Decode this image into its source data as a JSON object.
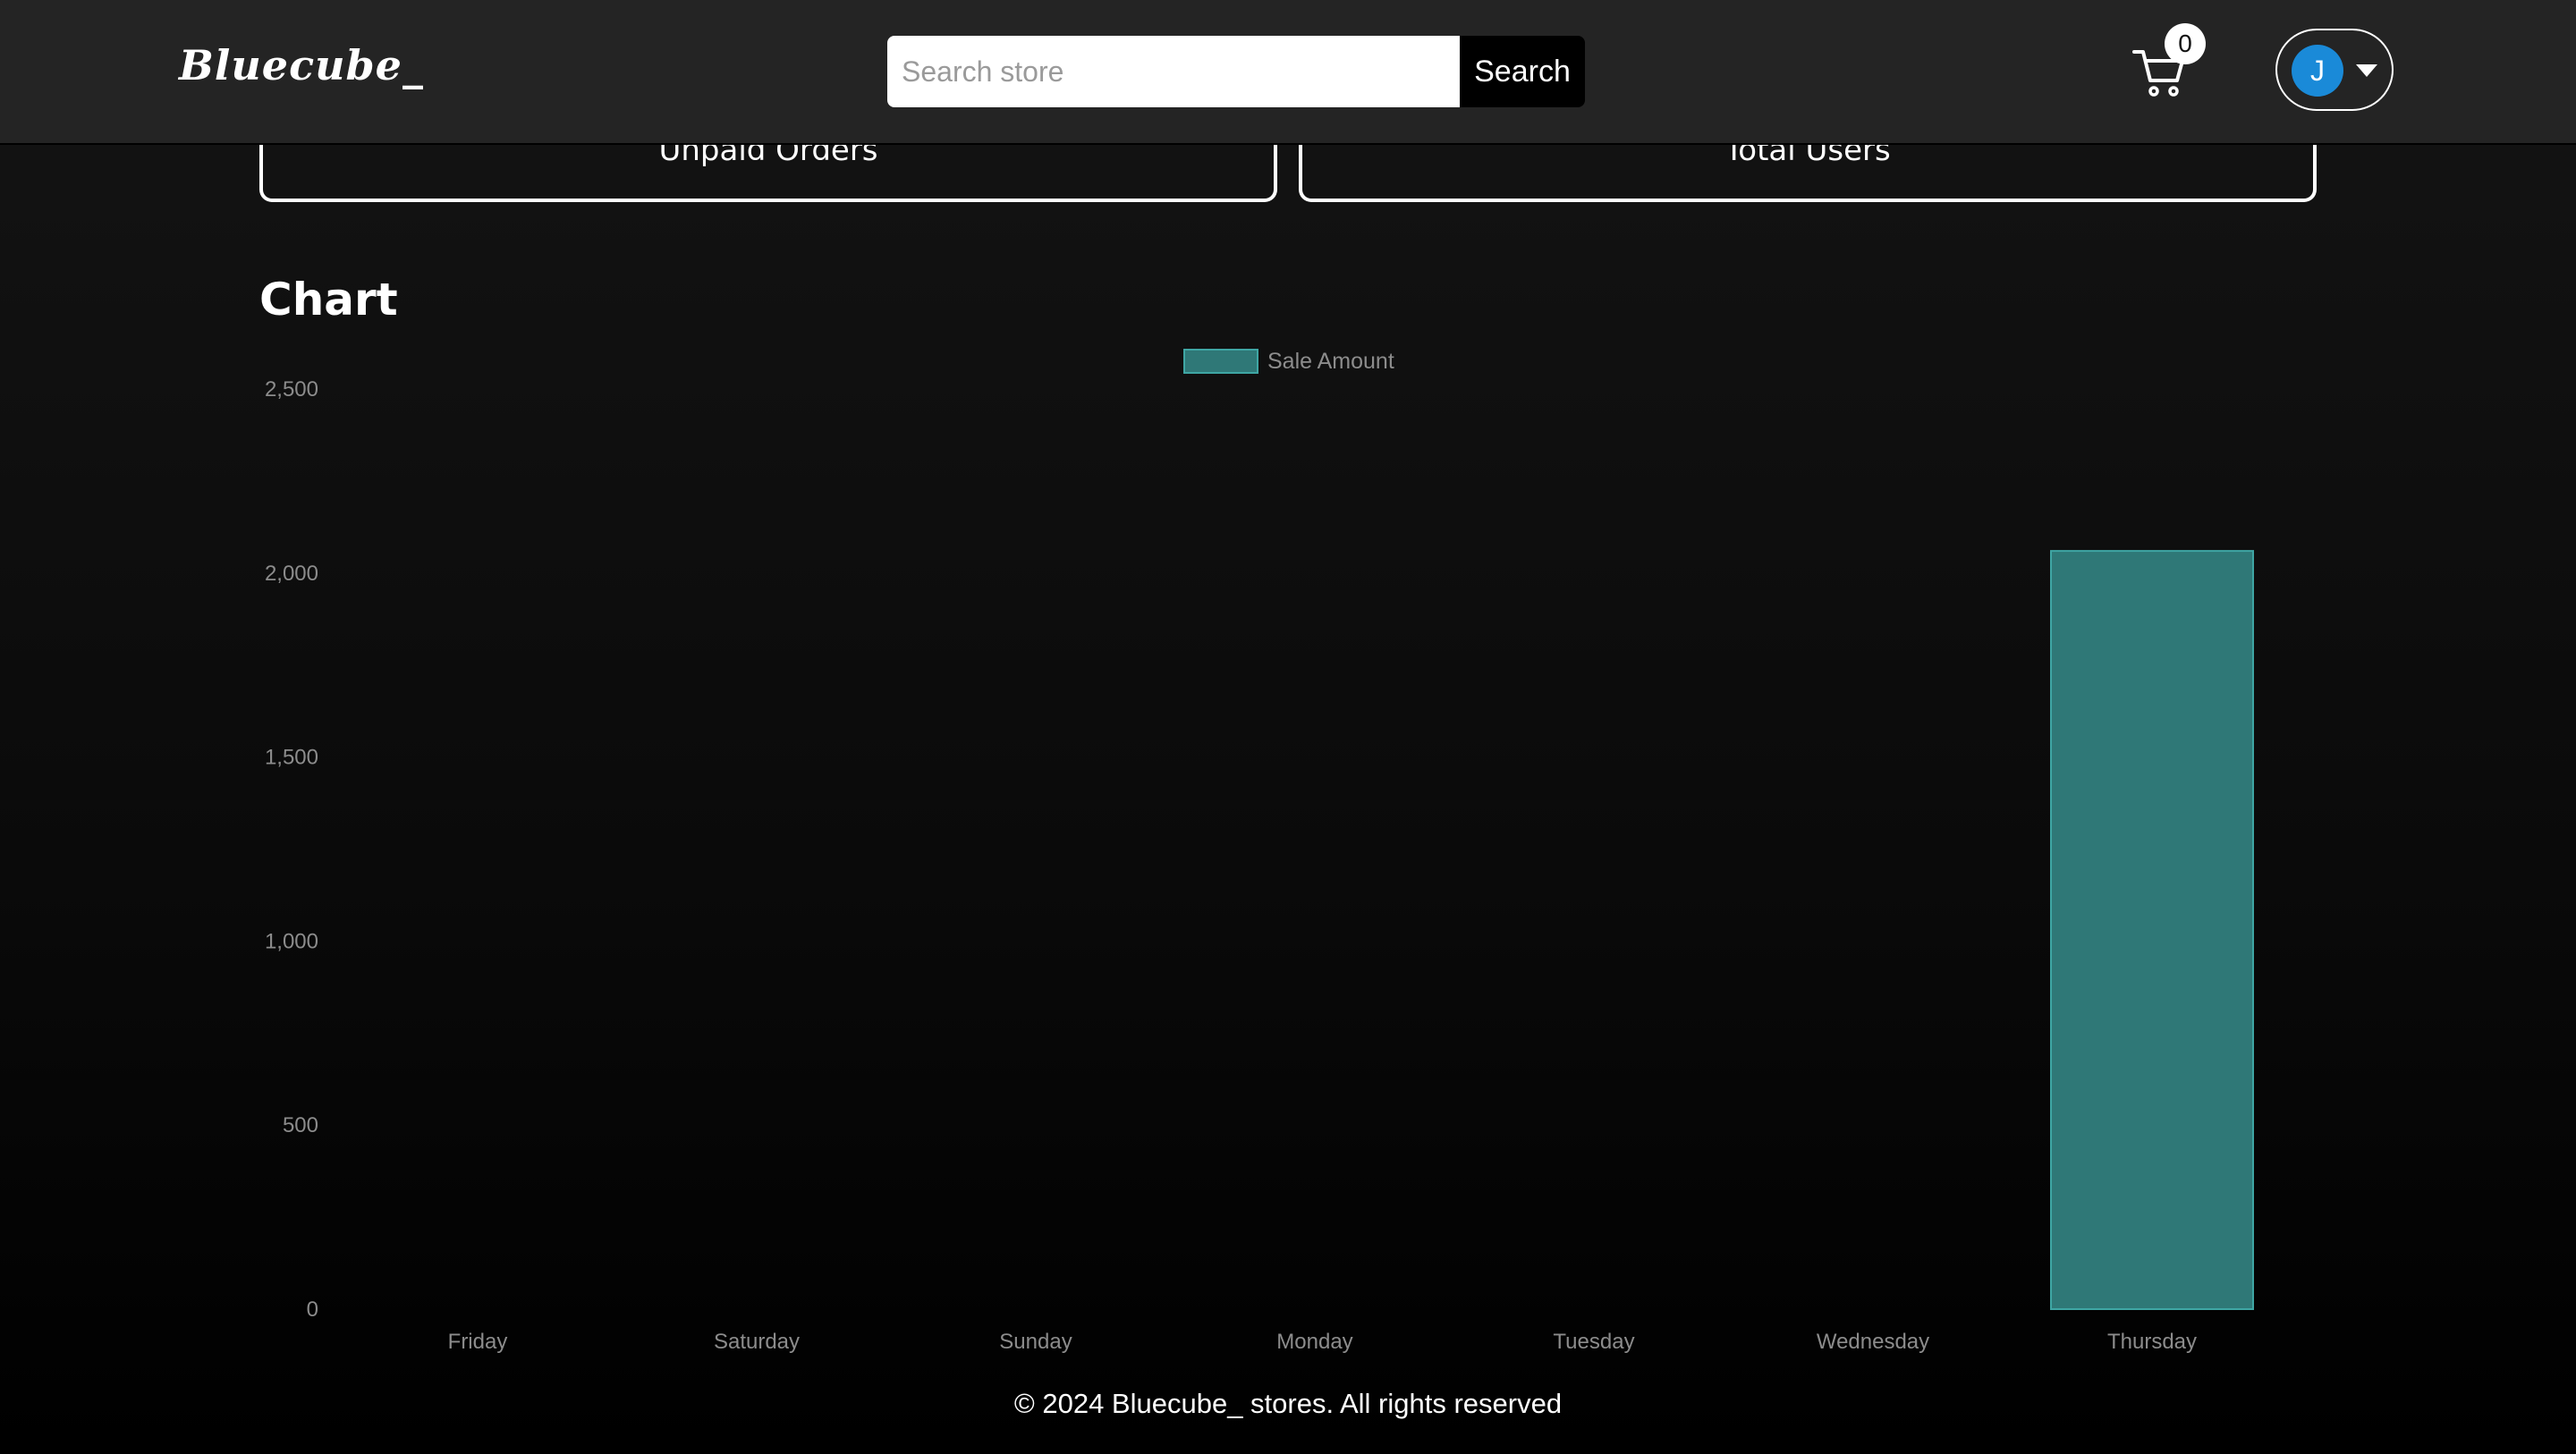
{
  "header": {
    "logo": "Bluecube_",
    "search": {
      "placeholder": "Search store",
      "value": "",
      "button_label": "Search"
    },
    "cart": {
      "count": "0",
      "icon": "cart-icon"
    },
    "user": {
      "initial": "J",
      "avatar_color": "#1a8ad8",
      "menu_icon": "caret-down-icon"
    }
  },
  "cards": [
    {
      "label": "Unpaid Orders"
    },
    {
      "label": "Total Users"
    }
  ],
  "section_title": "Chart",
  "chart_data": {
    "type": "bar",
    "categories": [
      "Friday",
      "Saturday",
      "Sunday",
      "Monday",
      "Tuesday",
      "Wednesday",
      "Thursday"
    ],
    "series": [
      {
        "name": "Sale Amount",
        "values": [
          0,
          0,
          0,
          0,
          0,
          0,
          2060
        ],
        "color": "#2f7877",
        "border_color": "#3fa6a4"
      }
    ],
    "ylim": [
      0,
      2500
    ],
    "yticks": [
      0,
      500,
      1000,
      1500,
      2000,
      2500
    ],
    "ytick_labels": [
      "0",
      "500",
      "1,000",
      "1,500",
      "2,000",
      "2,500"
    ],
    "legend_position": "top-center",
    "grid": false
  },
  "footer": {
    "text": "© 2024 Bluecube_ stores. All rights reserved"
  }
}
